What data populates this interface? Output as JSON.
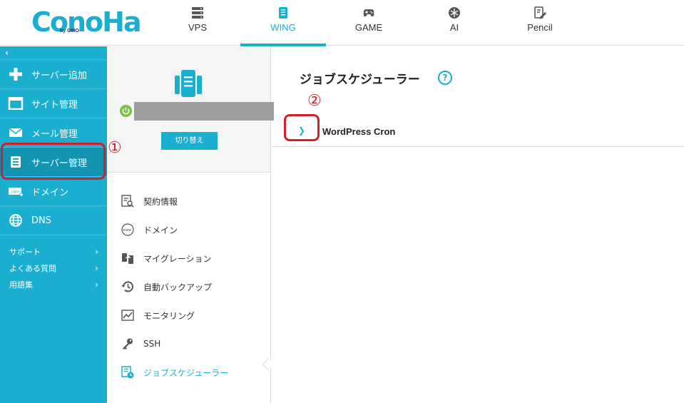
{
  "header": {
    "logo": "ConoHa",
    "logo_sub": "by GMO",
    "tabs": [
      {
        "label": "VPS",
        "icon": "server-stack-icon"
      },
      {
        "label": "WING",
        "icon": "mobile-device-icon"
      },
      {
        "label": "GAME",
        "icon": "gamepad-icon"
      },
      {
        "label": "AI",
        "icon": "ai-chip-icon"
      },
      {
        "label": "Pencil",
        "icon": "pencil-note-icon"
      }
    ],
    "active_tab": "WING"
  },
  "sidebar": {
    "collapse_icon": "‹",
    "items": [
      {
        "label": "サーバー追加",
        "icon": "plus-icon"
      },
      {
        "label": "サイト管理",
        "icon": "window-icon"
      },
      {
        "label": "メール管理",
        "icon": "mail-icon"
      },
      {
        "label": "サーバー管理",
        "icon": "server-icon"
      },
      {
        "label": "ドメイン",
        "icon": "domain-com-icon"
      },
      {
        "label": "DNS",
        "icon": "globe-icon"
      }
    ],
    "active_item": "サーバー管理",
    "links": [
      {
        "label": "サポート",
        "chevron": "›"
      },
      {
        "label": "よくある質問",
        "chevron": "›"
      },
      {
        "label": "用語集",
        "chevron": "›"
      }
    ]
  },
  "server_panel": {
    "switch_label": "切り替え",
    "menu": [
      {
        "label": "契約情報",
        "icon": "contract-search-icon"
      },
      {
        "label": "ドメイン",
        "icon": "www-globe-icon"
      },
      {
        "label": "マイグレーション",
        "icon": "migration-icon"
      },
      {
        "label": "自動バックアップ",
        "icon": "backup-clock-icon"
      },
      {
        "label": "モニタリング",
        "icon": "monitoring-chart-icon"
      },
      {
        "label": "SSH",
        "icon": "key-icon"
      },
      {
        "label": "ジョブスケジューラー",
        "icon": "scheduler-icon"
      }
    ],
    "active_menu": "ジョブスケジューラー"
  },
  "content": {
    "title": "ジョブスケジューラー",
    "help_icon": "?",
    "rows": [
      {
        "toggle": "❯",
        "label": "WordPress Cron"
      }
    ]
  },
  "annotations": {
    "one": "①",
    "two": "②",
    "color": "#d0202c"
  },
  "colors": {
    "brand": "#1aafd0",
    "sidebar_active": "#1394b3",
    "power": "#7ac143"
  }
}
